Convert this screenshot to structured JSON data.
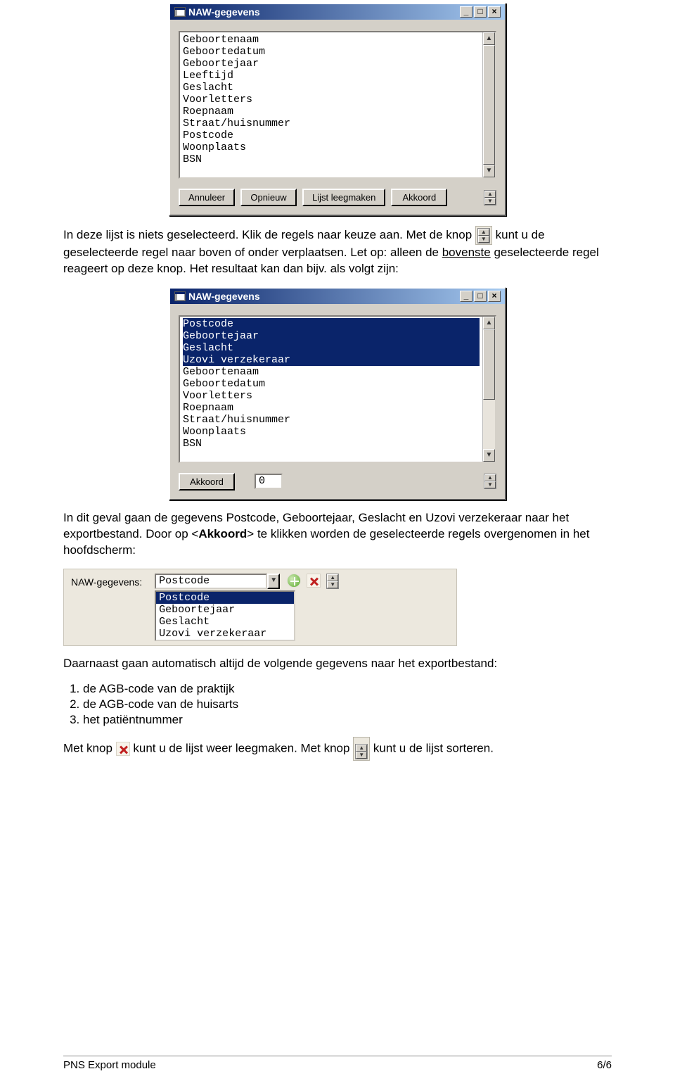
{
  "window1": {
    "title": "NAW-gegevens",
    "list": [
      "Geboortenaam",
      "Geboortedatum",
      "Geboortejaar",
      "Leeftijd",
      "Geslacht",
      "Voorletters",
      "Roepnaam",
      "Straat/huisnummer",
      "Postcode",
      "Woonplaats",
      "BSN"
    ],
    "buttons": {
      "annuleer": "Annuleer",
      "opnieuw": "Opnieuw",
      "lijst_leegmaken": "Lijst leegmaken",
      "akkoord": "Akkoord"
    }
  },
  "para1": {
    "t1": "In deze lijst is niets geselecteerd. Klik de regels naar keuze aan. Met de knop ",
    "t2": " kunt u de geselecteerde regel naar boven of onder verplaatsen. Let op: alleen de ",
    "bovenste": "bovenste",
    "t3": " geselecteerde regel reageert op deze knop. Het resultaat kan dan bijv. als volgt zijn:"
  },
  "window2": {
    "title": "NAW-gegevens",
    "list": [
      {
        "t": "Postcode",
        "sel": true
      },
      {
        "t": "Geboortejaar",
        "sel": true
      },
      {
        "t": "Geslacht",
        "sel": true
      },
      {
        "t": "Uzovi verzekeraar",
        "sel": true
      },
      {
        "t": "Geboortenaam",
        "sel": false
      },
      {
        "t": "Geboortedatum",
        "sel": false
      },
      {
        "t": "Voorletters",
        "sel": false
      },
      {
        "t": "Roepnaam",
        "sel": false
      },
      {
        "t": "Straat/huisnummer",
        "sel": false
      },
      {
        "t": "Woonplaats",
        "sel": false
      },
      {
        "t": "BSN",
        "sel": false
      }
    ],
    "buttons": {
      "akkoord": "Akkoord"
    },
    "input_value": "0"
  },
  "para2": {
    "t1": "In dit geval gaan de gegevens Postcode, Geboortejaar, Geslacht en Uzovi verzekeraar naar het exportbestand. Door op <",
    "akkoord": "Akkoord",
    "t2": "> te klikken worden de geselecteerde regels overgenomen in het hoofdscherm:"
  },
  "mainpanel": {
    "label": "NAW-gegevens:",
    "selected": "Postcode",
    "dropdown_list": [
      {
        "t": "Postcode",
        "sel": true
      },
      {
        "t": "Geboortejaar",
        "sel": false
      },
      {
        "t": "Geslacht",
        "sel": false
      },
      {
        "t": "Uzovi verzekeraar",
        "sel": false
      }
    ]
  },
  "para3": "Daarnaast gaan automatisch altijd de volgende gegevens naar het exportbestand:",
  "numlist": [
    "de AGB-code van de praktijk",
    "de AGB-code van de huisarts",
    "het patiëntnummer"
  ],
  "para4": {
    "t1": "Met knop ",
    "t2": " kunt u de lijst weer leegmaken. Met knop ",
    "t3": " kunt u de lijst sorteren."
  },
  "footer": {
    "left": "PNS Export module",
    "right": "6/6"
  }
}
